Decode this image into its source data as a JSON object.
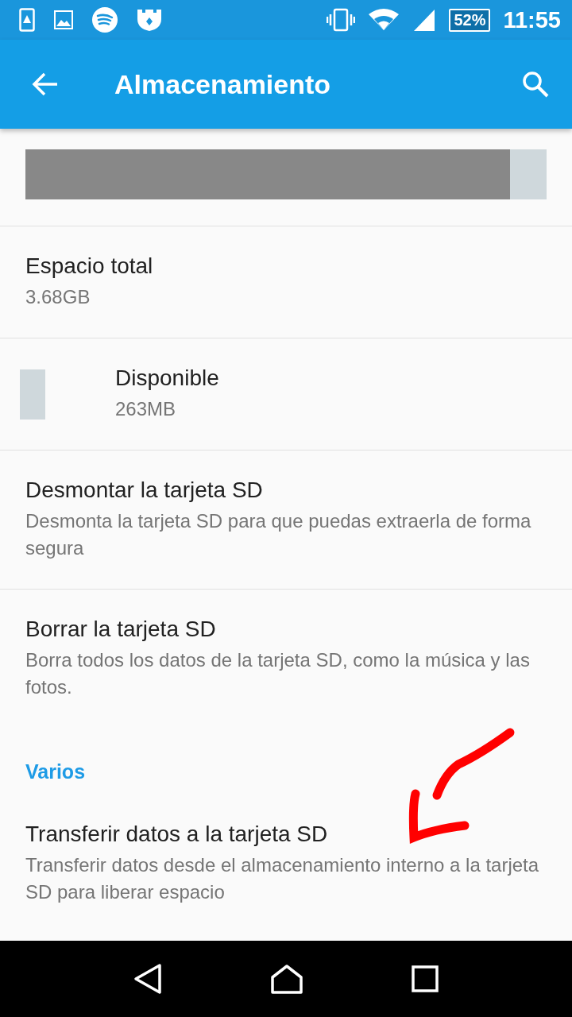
{
  "status_bar": {
    "battery": "52%",
    "time": "11:55"
  },
  "toolbar": {
    "title": "Almacenamiento"
  },
  "storage_bar": {
    "level": 0.93
  },
  "items": [
    {
      "kind": "plain",
      "title": "Espacio total",
      "subtitle": "3.68GB"
    },
    {
      "kind": "legend",
      "title": "Disponible",
      "subtitle": "263MB",
      "color": "#cfd8dc"
    },
    {
      "kind": "plain",
      "title": "Desmontar la tarjeta SD",
      "subtitle": "Desmonta la tarjeta SD para que puedas extraerla de forma segura"
    },
    {
      "kind": "plain",
      "title": "Borrar la tarjeta SD",
      "subtitle": "Borra todos los datos de la tarjeta SD, como la música y las fotos."
    },
    {
      "kind": "header",
      "title": "Varios"
    },
    {
      "kind": "plain",
      "title": "Transferir datos a la tarjeta SD",
      "subtitle": "Transferir datos desde el almacenamiento interno a la tarjeta SD para liberar espacio"
    }
  ]
}
